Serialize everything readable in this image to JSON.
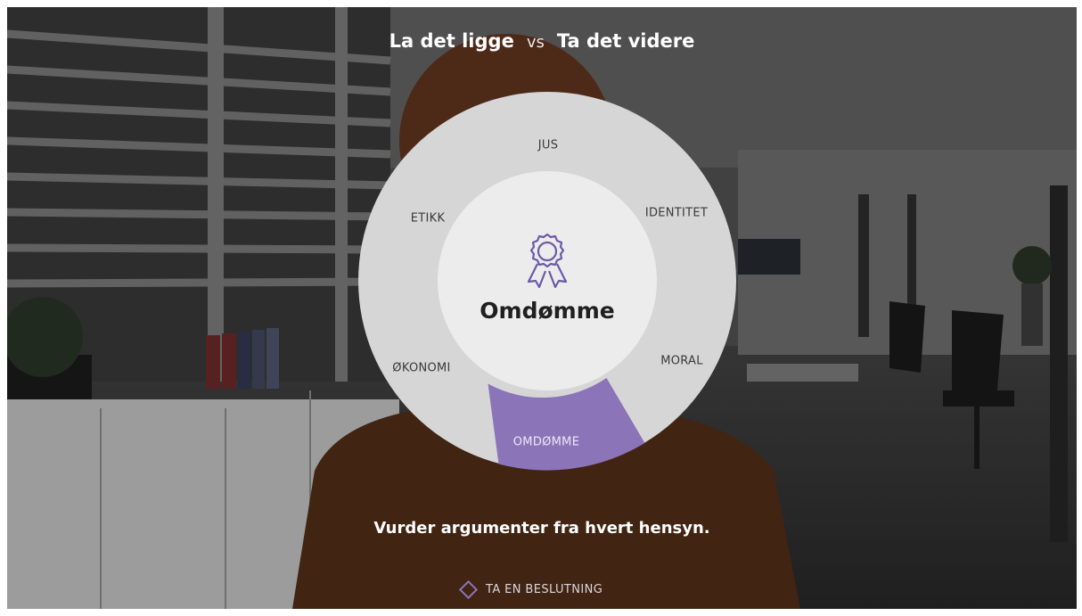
{
  "header": {
    "option_a": "La det ligge",
    "vs": "vs",
    "option_b": "Ta det videre"
  },
  "wheel": {
    "segments": [
      {
        "id": "jus",
        "label": "JUS",
        "active": false
      },
      {
        "id": "identitet",
        "label": "IDENTITET",
        "active": false
      },
      {
        "id": "moral",
        "label": "MORAL",
        "active": false
      },
      {
        "id": "omdomme",
        "label": "OMDØMME",
        "active": true
      },
      {
        "id": "okonomi",
        "label": "ØKONOMI",
        "active": false
      },
      {
        "id": "etikk",
        "label": "ETIKK",
        "active": false
      }
    ],
    "selected_title": "Omdømme",
    "selected_icon": "award-ribbon-icon",
    "colors": {
      "ring": "#d6d6d6",
      "center": "#ececec",
      "active": "#8b74b8",
      "icon": "#6b5aa6"
    }
  },
  "instruction": "Vurder argumenter fra hvert hensyn.",
  "decision": {
    "label": "TA EN BESLUTNING",
    "icon": "diamond-icon"
  }
}
